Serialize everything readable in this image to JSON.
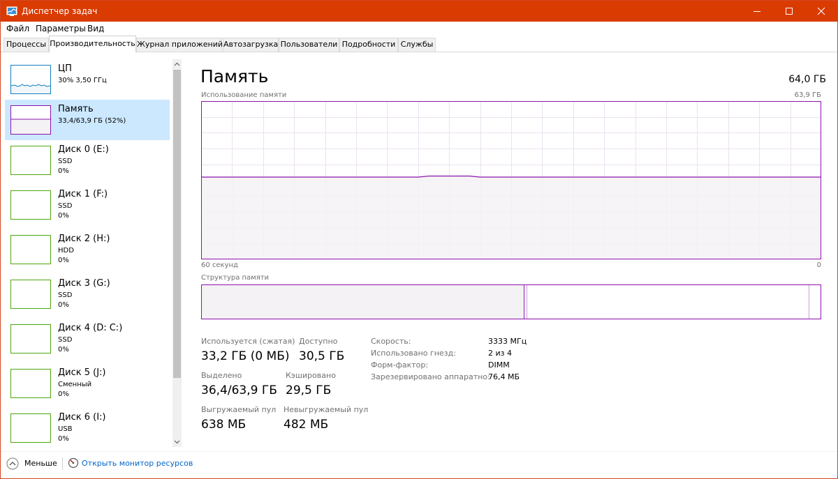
{
  "window": {
    "title": "Диспетчер задач"
  },
  "menu": [
    "Файл",
    "Параметры",
    "Вид"
  ],
  "tabs": [
    {
      "label": "Процессы",
      "active": false
    },
    {
      "label": "Производительность",
      "active": true
    },
    {
      "label": "Журнал приложений",
      "active": false
    },
    {
      "label": "Автозагрузка",
      "active": false
    },
    {
      "label": "Пользователи",
      "active": false
    },
    {
      "label": "Подробности",
      "active": false
    },
    {
      "label": "Службы",
      "active": false
    }
  ],
  "sidebar": {
    "items": [
      {
        "title": "ЦП",
        "line1": "30%  3,50 ГГц",
        "line2": "",
        "selected": false,
        "color": "#117dbb",
        "usage_percent": 30
      },
      {
        "title": "Память",
        "line1": "33,4/63,9 ГБ (52%)",
        "line2": "",
        "selected": true,
        "color": "#8b12ae",
        "usage_percent": 52
      },
      {
        "title": "Диск 0 (E:)",
        "line1": "SSD",
        "line2": "0%",
        "selected": false,
        "color": "#4da60c",
        "usage_percent": 0
      },
      {
        "title": "Диск 1 (F:)",
        "line1": "SSD",
        "line2": "0%",
        "selected": false,
        "color": "#4da60c",
        "usage_percent": 0
      },
      {
        "title": "Диск 2 (H:)",
        "line1": "HDD",
        "line2": "0%",
        "selected": false,
        "color": "#4da60c",
        "usage_percent": 0
      },
      {
        "title": "Диск 3 (G:)",
        "line1": "SSD",
        "line2": "0%",
        "selected": false,
        "color": "#4da60c",
        "usage_percent": 0
      },
      {
        "title": "Диск 4 (D: C:)",
        "line1": "SSD",
        "line2": "0%",
        "selected": false,
        "color": "#4da60c",
        "usage_percent": 0
      },
      {
        "title": "Диск 5 (J:)",
        "line1": "Сменный",
        "line2": "0%",
        "selected": false,
        "color": "#4da60c",
        "usage_percent": 0
      },
      {
        "title": "Диск 6 (I:)",
        "line1": "USB",
        "line2": "0%",
        "selected": false,
        "color": "#4da60c",
        "usage_percent": 0
      }
    ]
  },
  "detail": {
    "title": "Память",
    "total": "64,0 ГБ",
    "graph_label": "Использование памяти",
    "graph_max": "63,9 ГБ",
    "graph_time_left": "60 секунд",
    "graph_time_right": "0",
    "structure_label": "Структура памяти",
    "usage_fraction": 0.52,
    "structure": {
      "in_use_fraction": 0.522,
      "modified_fraction": 0.004,
      "standby_fraction": 0.455
    },
    "stats": {
      "in_use_label": "Используется (сжатая)",
      "in_use_value": "33,2 ГБ (0 МБ)",
      "available_label": "Доступно",
      "available_value": "30,5 ГБ",
      "committed_label": "Выделено",
      "committed_value": "36,4/63,9 ГБ",
      "cached_label": "Кэшировано",
      "cached_value": "29,5 ГБ",
      "paged_label": "Выгружаемый пул",
      "paged_value": "638 МБ",
      "nonpaged_label": "Невыгружаемый пул",
      "nonpaged_value": "482 МБ"
    },
    "properties": [
      {
        "label": "Скорость:",
        "value": "3333 МГц"
      },
      {
        "label": "Использовано гнезд:",
        "value": "2 из 4"
      },
      {
        "label": "Форм-фактор:",
        "value": "DIMM"
      },
      {
        "label": "Зарезервировано аппаратно:",
        "value": "76,4 МБ"
      }
    ]
  },
  "footer": {
    "fewer_label": "Меньше",
    "monitor_link": "Открыть монитор ресурсов"
  },
  "colors": {
    "titlebar": "#da3b01",
    "memory": "#8b12ae",
    "cpu": "#117dbb",
    "disk": "#4da60c",
    "selection": "#cce8ff",
    "link": "#0066cc"
  }
}
